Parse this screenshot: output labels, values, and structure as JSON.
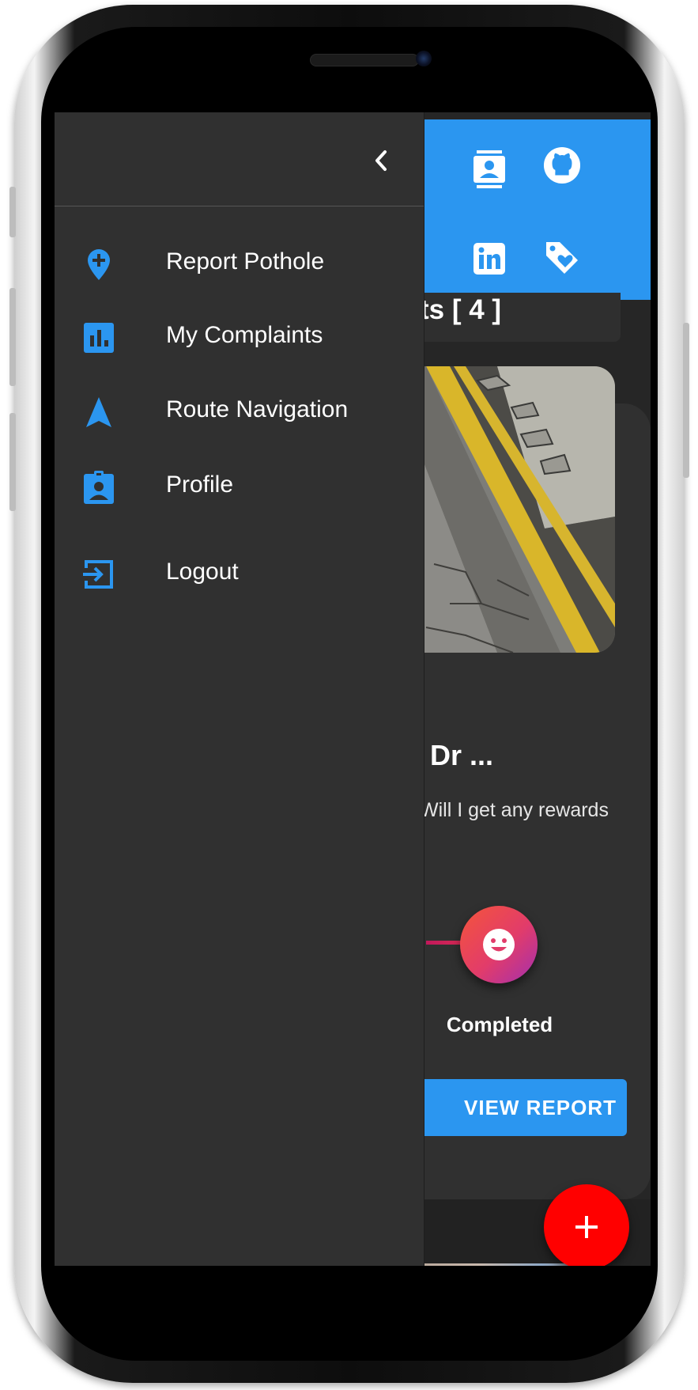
{
  "drawer": {
    "items": [
      {
        "label": "Report Pothole",
        "icon": "add-location-icon"
      },
      {
        "label": "My Complaints",
        "icon": "bar-chart-icon"
      },
      {
        "label": "Route Navigation",
        "icon": "navigation-arrow-icon"
      },
      {
        "label": "Profile",
        "icon": "badge-icon"
      },
      {
        "label": "Logout",
        "icon": "login-icon"
      }
    ]
  },
  "background": {
    "count_text": "ts  [ 4 ]",
    "card_title": "Dr ...",
    "card_desc": "Will I get any rewards",
    "status_label": "Completed",
    "view_button": "VIEW REPORT"
  },
  "colors": {
    "accent": "#2b96f0",
    "drawer_bg": "#303030",
    "fab": "#ff0000"
  }
}
